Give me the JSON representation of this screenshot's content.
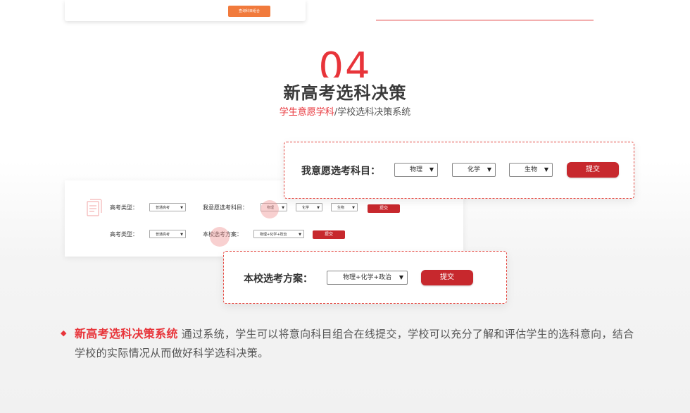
{
  "previous": {
    "button_label": "查询科目组合"
  },
  "section": {
    "number": "04",
    "title": "新高考选科决策",
    "subtitle_red": "学生意愿学科",
    "subtitle_rest": "/学校选科决策系统"
  },
  "form": {
    "row1": {
      "type_label": "高考类型：",
      "type_value": "普通高考",
      "subjects_label": "我意愿选考科目：",
      "subjects": [
        "物理",
        "化学",
        "生物"
      ],
      "submit": "提交"
    },
    "row2": {
      "type_label": "高考类型：",
      "type_value": "普通高考",
      "plan_label": "本校选考方案：",
      "plan_value": "物理+化学+政治",
      "submit": "提交"
    }
  },
  "popup1": {
    "label": "我意愿选考科目：",
    "subjects": [
      "物理",
      "化学",
      "生物"
    ],
    "submit": "提交"
  },
  "popup2": {
    "label": "本校选考方案：",
    "plan_value": "物理+化学+政治",
    "submit": "提交"
  },
  "description": {
    "highlight": "新高考选科决策系统",
    "text": "通过系统，学生可以将意向科目组合在线提交，学校可以充分了解和评估学生的选科意向，结合学校的实际情况从而做好科学选科决策。"
  },
  "colors": {
    "accent": "#e8343a",
    "button": "#c7282d",
    "orange": "#f17a3c"
  }
}
